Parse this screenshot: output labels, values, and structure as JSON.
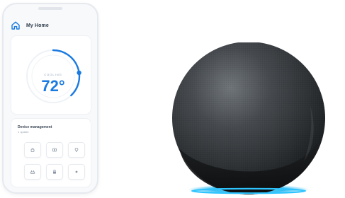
{
  "phone": {
    "header": {
      "title": "My Home",
      "icon": "home-icon"
    },
    "thermostat": {
      "mode_label": "COOLING",
      "temperature": "72°",
      "setpoint_fraction": 0.38,
      "accent_color": "#1a7ae0"
    },
    "devices": {
      "title": "Device management",
      "subtitle": "1 update",
      "tiles": [
        {
          "icon": "plug-icon"
        },
        {
          "icon": "camera-icon"
        },
        {
          "icon": "bulb-icon"
        },
        {
          "icon": "router-icon"
        },
        {
          "icon": "lock-icon"
        },
        {
          "icon": "sensor-icon"
        }
      ]
    }
  },
  "speaker": {
    "type": "smart-speaker",
    "fabric_color": "#2f3336",
    "ring_color": "#1fb6f0"
  }
}
